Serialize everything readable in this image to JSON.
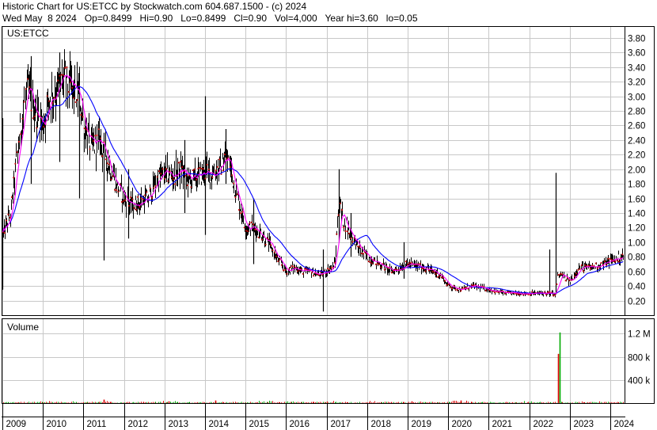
{
  "header": {
    "line1": "Historic Chart for US:ETCC by Stockwatch.com 604.687.1500 - (c) 2024",
    "line2": "Wed May  8 2024   Op=0.8499   Hi=0.90   Lo=0.8499   Cl=0.90   Vol=4,000   Year hi=3.60   lo=0.05"
  },
  "colors": {
    "price_bars": "#000000",
    "close_dots": "#cc0000",
    "ma_short": "#ff00ff",
    "ma_long": "#0000ff",
    "volume_up": "#00aa00",
    "volume_down": "#dd0000",
    "grid": "#c8c8c8"
  },
  "chart_data": [
    {
      "type": "line",
      "title": "US:ETCC",
      "xlim": [
        2009.0,
        2024.35
      ],
      "ylim": [
        0.0,
        3.95
      ],
      "y_ticks": [
        "3.80",
        "3.60",
        "3.40",
        "3.20",
        "3.00",
        "2.80",
        "2.60",
        "2.40",
        "2.20",
        "2.00",
        "1.80",
        "1.60",
        "1.40",
        "1.20",
        "1.00",
        "0.80",
        "0.60",
        "0.40",
        "0.20"
      ],
      "x_ticks": [
        "2009",
        "2010",
        "2011",
        "2012",
        "2013",
        "2014",
        "2015",
        "2016",
        "2017",
        "2018",
        "2019",
        "2020",
        "2021",
        "2022",
        "2023",
        "2024"
      ],
      "grid": true,
      "anchors": [
        [
          2009.0,
          1.1
        ],
        [
          2009.2,
          1.4
        ],
        [
          2009.4,
          2.4
        ],
        [
          2009.6,
          3.1
        ],
        [
          2009.8,
          2.8
        ],
        [
          2010.0,
          2.6
        ],
        [
          2010.15,
          3.0
        ],
        [
          2010.3,
          3.05
        ],
        [
          2010.5,
          3.25
        ],
        [
          2010.7,
          3.1
        ],
        [
          2010.9,
          3.0
        ],
        [
          2011.0,
          2.6
        ],
        [
          2011.2,
          2.3
        ],
        [
          2011.4,
          2.4
        ],
        [
          2011.6,
          2.1
        ],
        [
          2011.8,
          1.8
        ],
        [
          2012.0,
          1.6
        ],
        [
          2012.2,
          1.5
        ],
        [
          2012.4,
          1.55
        ],
        [
          2012.6,
          1.6
        ],
        [
          2012.8,
          1.85
        ],
        [
          2013.0,
          1.95
        ],
        [
          2013.2,
          1.9
        ],
        [
          2013.4,
          2.0
        ],
        [
          2013.6,
          1.85
        ],
        [
          2013.8,
          1.9
        ],
        [
          2014.0,
          1.95
        ],
        [
          2014.2,
          1.95
        ],
        [
          2014.4,
          2.05
        ],
        [
          2014.5,
          2.2
        ],
        [
          2014.6,
          2.05
        ],
        [
          2014.8,
          1.6
        ],
        [
          2015.0,
          1.2
        ],
        [
          2015.2,
          1.2
        ],
        [
          2015.4,
          1.1
        ],
        [
          2015.6,
          0.95
        ],
        [
          2015.8,
          0.75
        ],
        [
          2016.0,
          0.6
        ],
        [
          2016.2,
          0.65
        ],
        [
          2016.4,
          0.6
        ],
        [
          2016.6,
          0.6
        ],
        [
          2016.8,
          0.55
        ],
        [
          2017.0,
          0.6
        ],
        [
          2017.2,
          0.7
        ],
        [
          2017.3,
          1.55
        ],
        [
          2017.4,
          1.3
        ],
        [
          2017.6,
          1.1
        ],
        [
          2017.8,
          0.9
        ],
        [
          2018.0,
          0.8
        ],
        [
          2018.3,
          0.7
        ],
        [
          2018.6,
          0.6
        ],
        [
          2019.0,
          0.7
        ],
        [
          2019.4,
          0.65
        ],
        [
          2019.8,
          0.55
        ],
        [
          2020.0,
          0.4
        ],
        [
          2020.3,
          0.35
        ],
        [
          2020.6,
          0.4
        ],
        [
          2021.0,
          0.35
        ],
        [
          2021.4,
          0.3
        ],
        [
          2021.8,
          0.3
        ],
        [
          2022.2,
          0.3
        ],
        [
          2022.5,
          0.3
        ],
        [
          2022.65,
          0.28
        ],
        [
          2022.7,
          0.55
        ],
        [
          2022.8,
          0.55
        ],
        [
          2023.0,
          0.45
        ],
        [
          2023.2,
          0.65
        ],
        [
          2023.5,
          0.65
        ],
        [
          2023.8,
          0.7
        ],
        [
          2024.0,
          0.75
        ],
        [
          2024.3,
          0.8
        ]
      ],
      "spikes": [
        [
          2009.0,
          2.7,
          0.35
        ],
        [
          2009.7,
          3.55,
          1.8
        ],
        [
          2010.4,
          3.6,
          2.1
        ],
        [
          2010.9,
          3.1,
          1.6
        ],
        [
          2011.5,
          2.5,
          0.75
        ],
        [
          2012.1,
          2.0,
          1.05
        ],
        [
          2013.5,
          2.4,
          1.4
        ],
        [
          2014.0,
          3.0,
          1.1
        ],
        [
          2014.5,
          2.55,
          1.8
        ],
        [
          2015.2,
          1.6,
          0.7
        ],
        [
          2016.9,
          0.9,
          0.05
        ],
        [
          2017.3,
          2.0,
          1.0
        ],
        [
          2017.6,
          1.4,
          0.8
        ],
        [
          2018.9,
          1.0,
          0.5
        ],
        [
          2022.65,
          1.95,
          0.3
        ],
        [
          2022.5,
          0.9,
          0.25
        ]
      ]
    },
    {
      "type": "bar",
      "title": "Volume",
      "y_ticks": [
        "1.2 M",
        "800 k",
        "400 k"
      ],
      "ylim": [
        0,
        1450000
      ],
      "spikes": [
        [
          2011.5,
          60000
        ],
        [
          2013.1,
          30000
        ],
        [
          2014.25,
          45000
        ],
        [
          2017.0,
          25000
        ],
        [
          2019.1,
          30000
        ],
        [
          2020.3,
          45000
        ],
        [
          2022.7,
          850000
        ],
        [
          2022.72,
          1220000
        ]
      ]
    }
  ]
}
